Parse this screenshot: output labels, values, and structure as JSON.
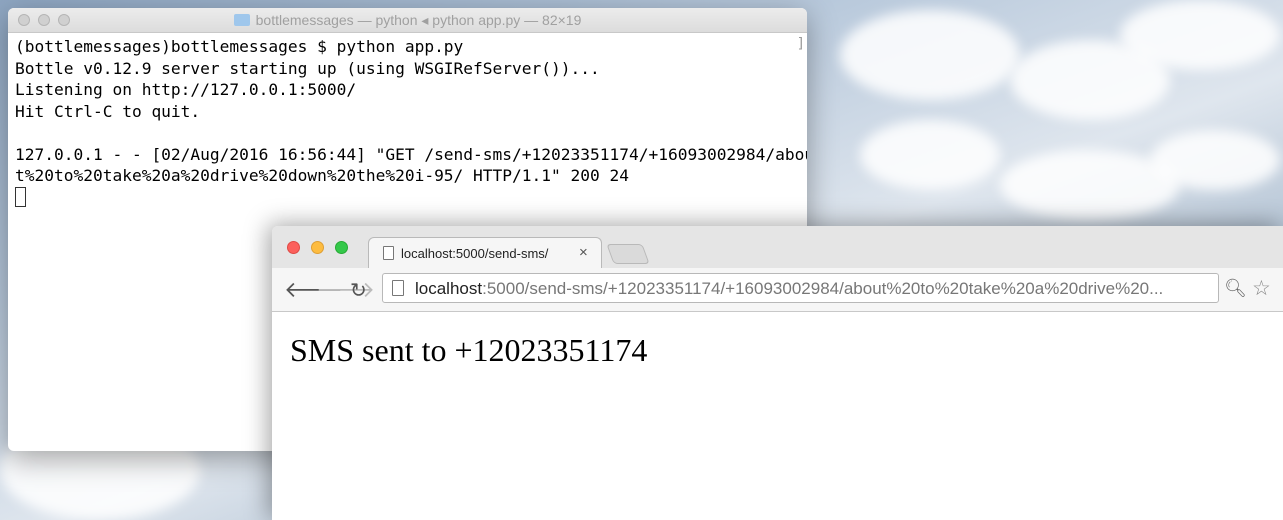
{
  "terminal": {
    "title": "bottlemessages — python ◂ python app.py — 82×19",
    "lines": [
      "(bottlemessages)bottlemessages $ python app.py",
      "Bottle v0.12.9 server starting up (using WSGIRefServer())...",
      "Listening on http://127.0.0.1:5000/",
      "Hit Ctrl-C to quit.",
      "",
      "127.0.0.1 - - [02/Aug/2016 16:56:44] \"GET /send-sms/+12023351174/+16093002984/abou",
      "t%20to%20take%20a%20drive%20down%20the%20i-95/ HTTP/1.1\" 200 24"
    ]
  },
  "browser": {
    "tab_title": "localhost:5000/send-sms/",
    "tab_close": "×",
    "url_host": "localhost",
    "url_rest": ":5000/send-sms/+12023351174/+16093002984/about%20to%20take%20a%20drive%20...",
    "page_text": "SMS sent to +12023351174",
    "icons": [
      "back-icon",
      "forward-icon",
      "reload-icon",
      "zoom-icon",
      "star-icon"
    ]
  }
}
